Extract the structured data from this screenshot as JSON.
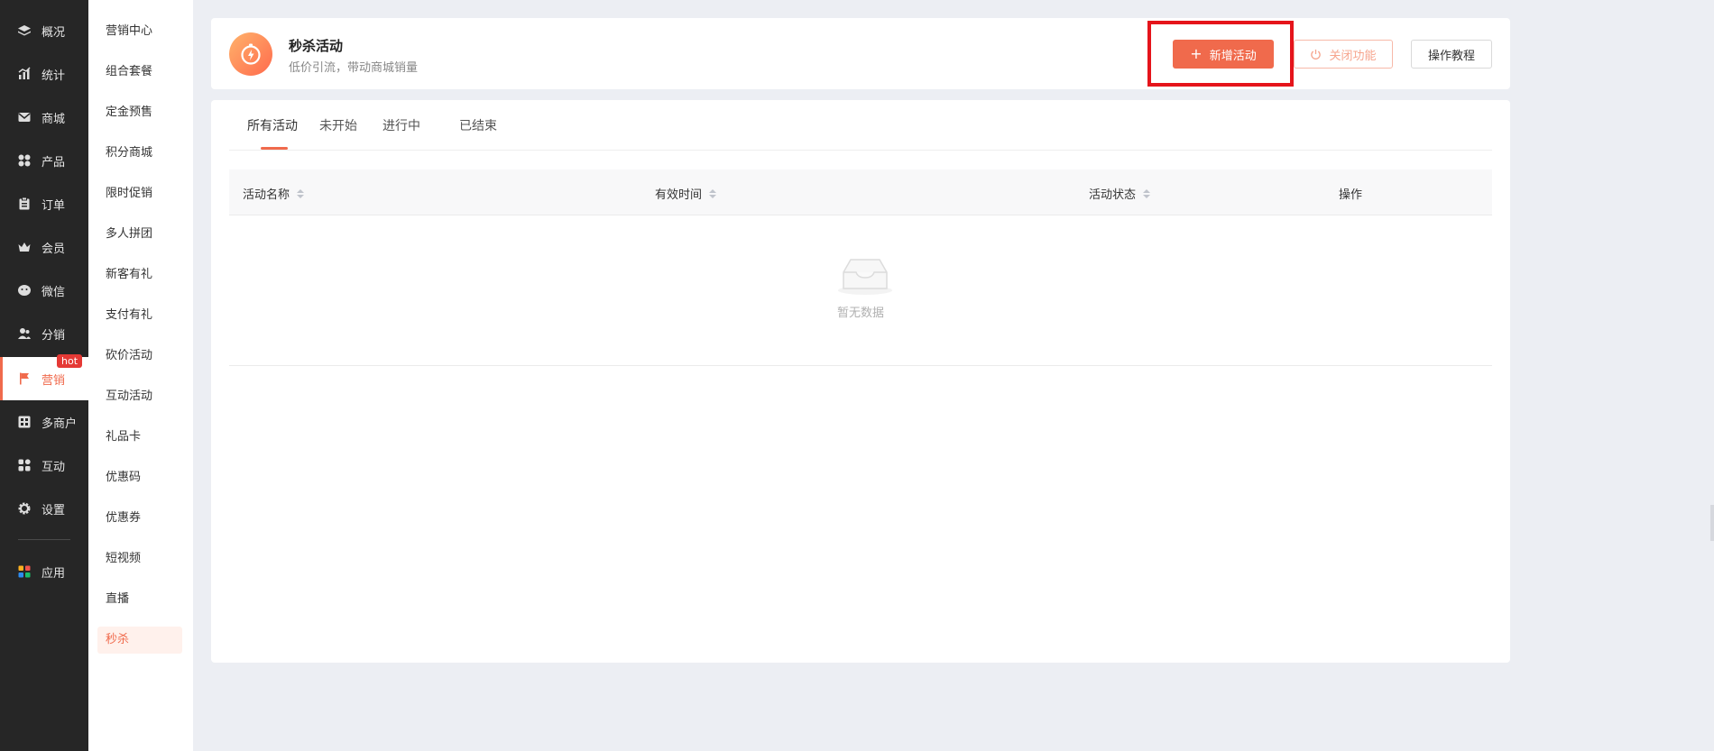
{
  "nav": {
    "items": [
      {
        "label": "概况",
        "icon": "layers-icon"
      },
      {
        "label": "统计",
        "icon": "chart-icon"
      },
      {
        "label": "商城",
        "icon": "mail-icon"
      },
      {
        "label": "产品",
        "icon": "grid-icon"
      },
      {
        "label": "订单",
        "icon": "clipboard-icon"
      },
      {
        "label": "会员",
        "icon": "crown-icon"
      },
      {
        "label": "微信",
        "icon": "wechat-icon"
      },
      {
        "label": "分销",
        "icon": "users-icon"
      },
      {
        "label": "营销",
        "icon": "flag-icon"
      },
      {
        "label": "多商户",
        "icon": "store-icon"
      },
      {
        "label": "互动",
        "icon": "apps-icon"
      },
      {
        "label": "设置",
        "icon": "gear-icon"
      },
      {
        "label": "应用",
        "icon": "app-colored-icon"
      }
    ],
    "hot_badge": "hot",
    "active_index": 8
  },
  "subnav": {
    "items": [
      "营销中心",
      "组合套餐",
      "定金预售",
      "积分商城",
      "限时促销",
      "多人拼团",
      "新客有礼",
      "支付有礼",
      "砍价活动",
      "互动活动",
      "礼品卡",
      "优惠码",
      "优惠券",
      "短视频",
      "直播",
      "秒杀"
    ],
    "active_index": 15
  },
  "header": {
    "title": "秒杀活动",
    "subtitle": "低价引流，带动商城销量",
    "add_button": "新增活动",
    "disable_button": "关闭功能",
    "tutorial_button": "操作教程"
  },
  "tabs": [
    "所有活动",
    "未开始",
    "进行中",
    "已结束"
  ],
  "table": {
    "columns": [
      "活动名称",
      "有效时间",
      "活动状态",
      "操作"
    ],
    "empty_text": "暂无数据"
  },
  "colors": {
    "accent": "#f06a4c",
    "nav_bg": "#262626",
    "highlight": "#e5141b"
  }
}
